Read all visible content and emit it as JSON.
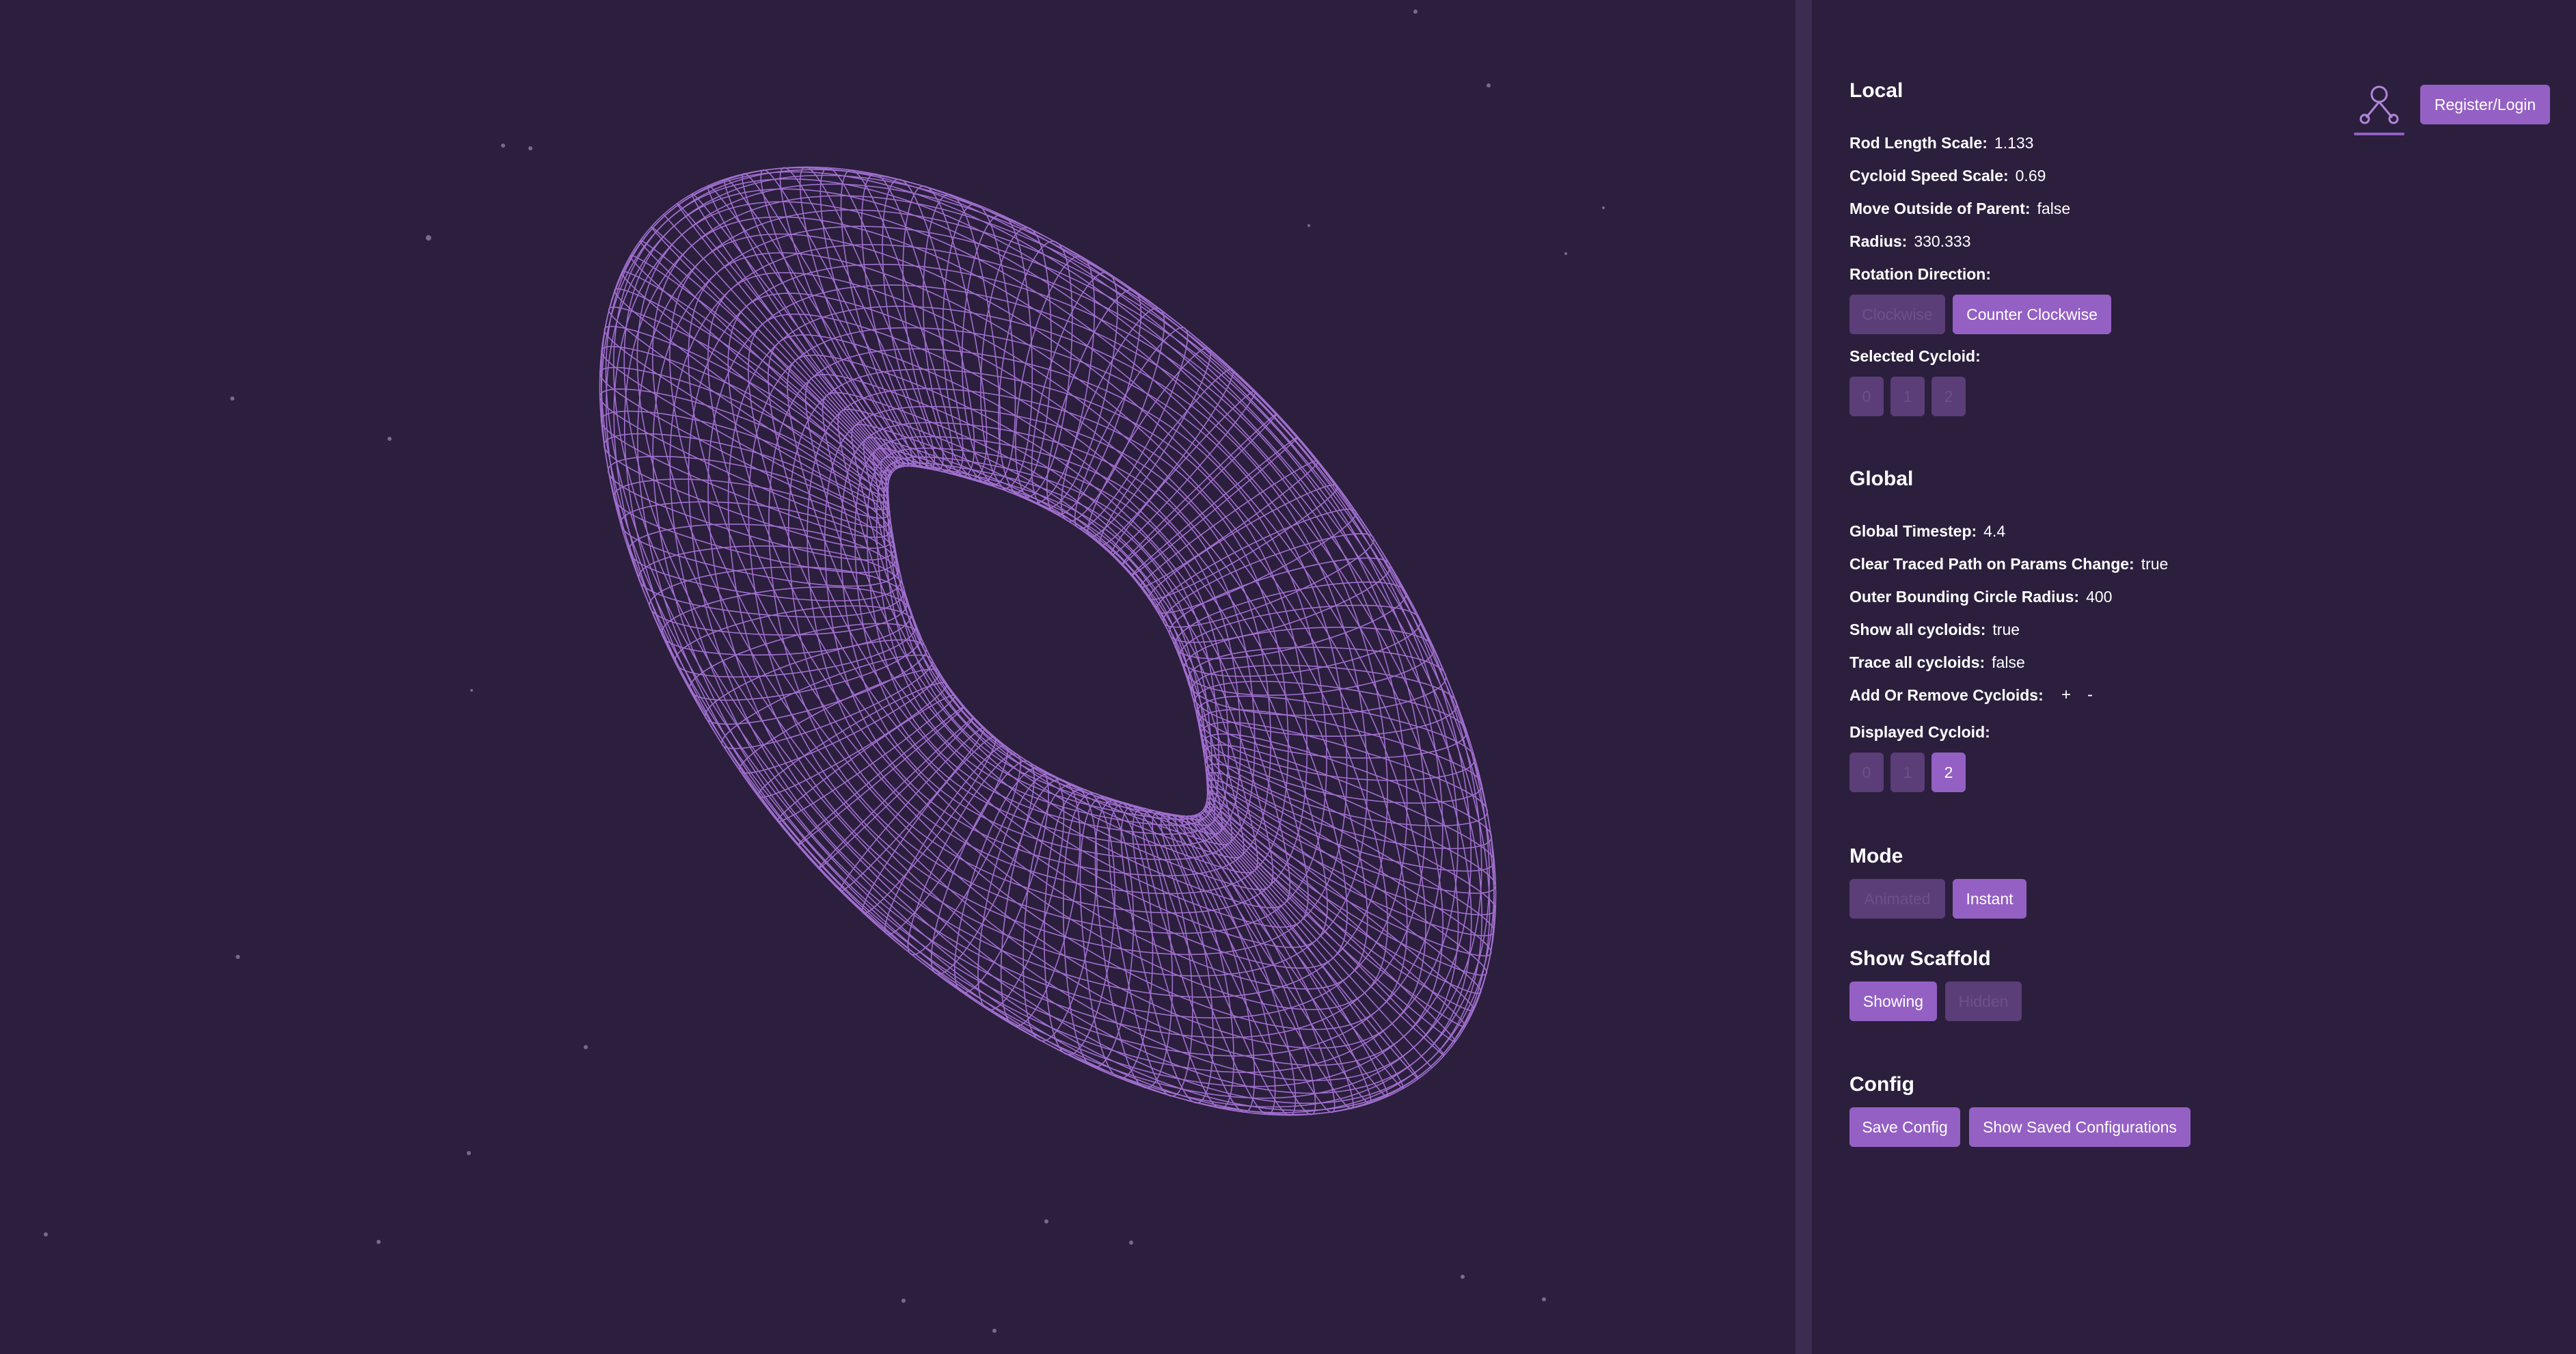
{
  "header": {
    "login_label": "Register/Login",
    "user_icon": "user-network-icon"
  },
  "local": {
    "title": "Local",
    "rod_length_scale": {
      "label": "Rod Length Scale:",
      "value": "1.133"
    },
    "cycloid_speed_scale": {
      "label": "Cycloid Speed Scale:",
      "value": "0.69"
    },
    "move_outside_of_parent": {
      "label": "Move Outside of Parent:",
      "value": "false"
    },
    "radius": {
      "label": "Radius:",
      "value": "330.333"
    },
    "rotation_direction": {
      "label": "Rotation Direction:",
      "options": [
        "Clockwise",
        "Counter Clockwise"
      ],
      "selected": "Counter Clockwise"
    },
    "selected_cycloid": {
      "label": "Selected Cycloid:",
      "options": [
        "0",
        "1",
        "2"
      ]
    }
  },
  "global": {
    "title": "Global",
    "global_timestep": {
      "label": "Global Timestep:",
      "value": "4.4"
    },
    "clear_traced_path": {
      "label": "Clear Traced Path on Params Change:",
      "value": "true"
    },
    "outer_bounding_radius": {
      "label": "Outer Bounding Circle Radius:",
      "value": "400"
    },
    "show_all_cycloids": {
      "label": "Show all cycloids:",
      "value": "true"
    },
    "trace_all_cycloids": {
      "label": "Trace all cycloids:",
      "value": "false"
    },
    "add_remove": {
      "label": "Add Or Remove Cycloids:",
      "plus": "+",
      "minus": "-"
    },
    "displayed_cycloid": {
      "label": "Displayed Cycloid:",
      "options": [
        "0",
        "1",
        "2"
      ],
      "selected": "2"
    }
  },
  "mode": {
    "title": "Mode",
    "options": [
      "Animated",
      "Instant"
    ],
    "selected": "Instant"
  },
  "scaffold": {
    "title": "Show Scaffold",
    "options": [
      "Showing",
      "Hidden"
    ],
    "selected": "Showing"
  },
  "config": {
    "title": "Config",
    "save_label": "Save Config",
    "show_saved_label": "Show Saved Configurations"
  },
  "colors": {
    "background": "#2b1f3d",
    "accent": "#9460c4",
    "accent_dim": "#5b3d78",
    "curve": "#b57ee8"
  }
}
